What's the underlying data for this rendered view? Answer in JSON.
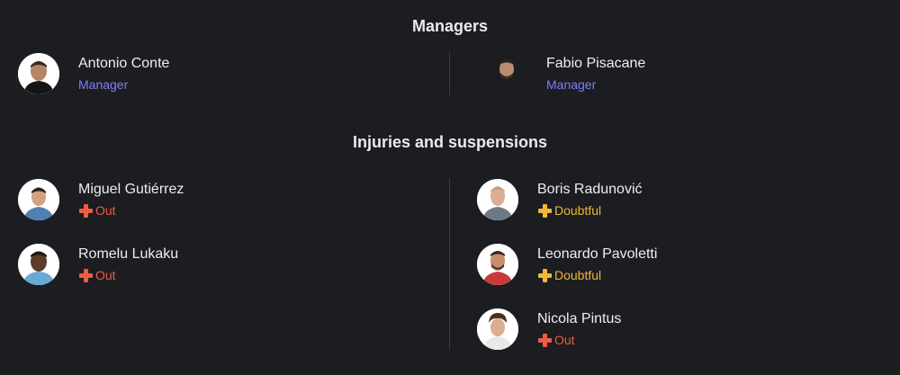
{
  "managers_section": {
    "title": "Managers",
    "items": [
      {
        "name": "Antonio Conte",
        "role": "Manager"
      },
      {
        "name": "Fabio Pisacane",
        "role": "Manager"
      }
    ]
  },
  "injuries_section": {
    "title": "Injuries and suspensions",
    "left": [
      {
        "name": "Miguel Gutiérrez",
        "status": "Out"
      },
      {
        "name": "Romelu Lukaku",
        "status": "Out"
      }
    ],
    "right": [
      {
        "name": "Boris Radunović",
        "status": "Doubtful"
      },
      {
        "name": "Leonardo Pavoletti",
        "status": "Doubtful"
      },
      {
        "name": "Nicola Pintus",
        "status": "Out"
      }
    ]
  },
  "colors": {
    "background": "#1b1d20",
    "role": "#7b7fff",
    "out": "#ec5b43",
    "doubtful": "#f1b639",
    "divider": "#383b40"
  },
  "icons": {
    "out": "red-cross-icon",
    "doubtful": "yellow-cross-icon"
  }
}
